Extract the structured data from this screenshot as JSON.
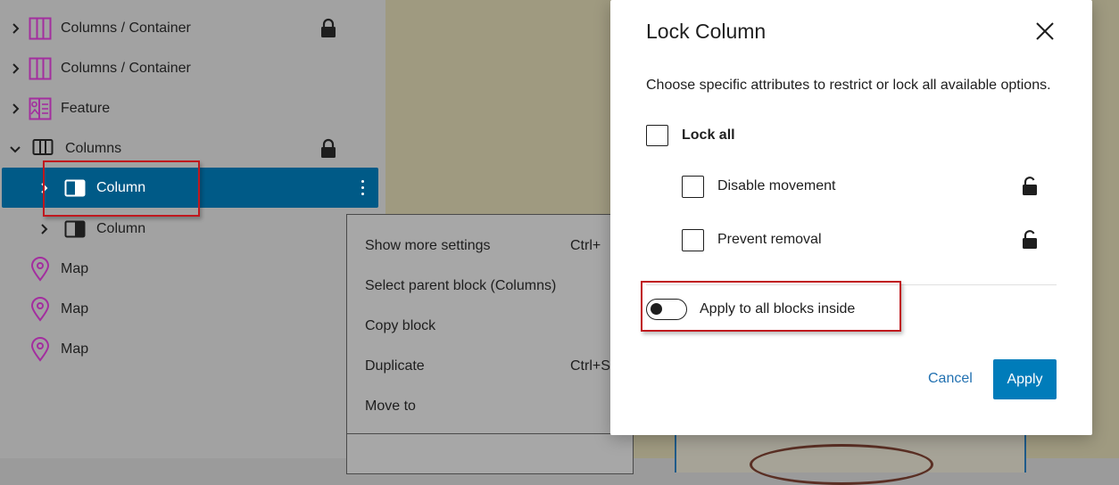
{
  "list_view": {
    "rows": [
      {
        "label": "Columns / Container",
        "icon": "columns-container-icon",
        "locked": true
      },
      {
        "label": "Columns / Container",
        "icon": "columns-container-icon",
        "locked": false
      },
      {
        "label": "Feature",
        "icon": "feature-icon",
        "locked": false
      },
      {
        "label": "Columns",
        "icon": "columns-icon",
        "locked": true
      },
      {
        "label": "Column",
        "icon": "column-icon",
        "selected": true
      },
      {
        "label": "Column",
        "icon": "column-icon"
      },
      {
        "label": "Map",
        "icon": "map-pin-icon"
      },
      {
        "label": "Map",
        "icon": "map-pin-icon"
      },
      {
        "label": "Map",
        "icon": "map-pin-icon"
      }
    ]
  },
  "context_menu": {
    "items": [
      {
        "label": "Show more settings",
        "shortcut": "Ctrl+"
      },
      {
        "label": "Select parent block (Columns)",
        "shortcut": ""
      },
      {
        "label": "Copy block",
        "shortcut": ""
      },
      {
        "label": "Duplicate",
        "shortcut": "Ctrl+S"
      },
      {
        "label": "Move to",
        "shortcut": ""
      }
    ]
  },
  "modal": {
    "title": "Lock Column",
    "description": "Choose specific attributes to restrict or lock all available options.",
    "lock_all_label": "Lock all",
    "options": [
      {
        "label": "Disable movement"
      },
      {
        "label": "Prevent removal"
      }
    ],
    "toggle_label": "Apply to all blocks inside",
    "toggle_on": false,
    "cancel_label": "Cancel",
    "apply_label": "Apply"
  },
  "colors": {
    "selected_row": "#005a87",
    "primary_button": "#007cba",
    "link": "#2271b1",
    "highlight_box": "#c0181e",
    "block_icon_purple": "#a32e9f"
  }
}
